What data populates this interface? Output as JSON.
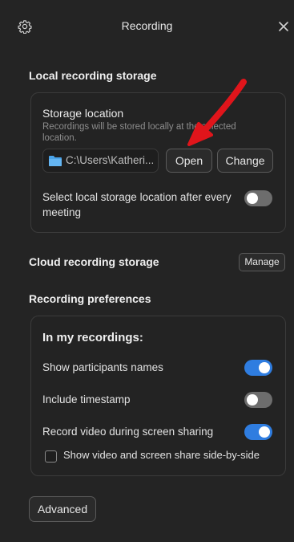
{
  "header": {
    "title": "Recording",
    "settings_icon": "gear-icon",
    "close_icon": "close-icon"
  },
  "local_storage": {
    "section_title": "Local recording storage",
    "label": "Storage location",
    "description": "Recordings will be stored locally at the selected location.",
    "path": "C:\\Users\\Katheri...",
    "open_label": "Open",
    "change_label": "Change",
    "select_after_meeting_label": "Select local storage location after every meeting",
    "select_after_meeting_on": false
  },
  "cloud_storage": {
    "section_title": "Cloud recording storage",
    "manage_label": "Manage"
  },
  "preferences": {
    "section_title": "Recording preferences",
    "group_title": "In my recordings:",
    "items": [
      {
        "label": "Show participants names",
        "on": true
      },
      {
        "label": "Include timestamp",
        "on": false
      },
      {
        "label": "Record video during screen sharing",
        "on": true
      }
    ],
    "side_by_side_label": "Show video and screen share side-by-side",
    "side_by_side_checked": false
  },
  "advanced_label": "Advanced",
  "colors": {
    "background": "#242424",
    "accent_toggle": "#2f7de0",
    "annotation_arrow": "#e0151b"
  }
}
